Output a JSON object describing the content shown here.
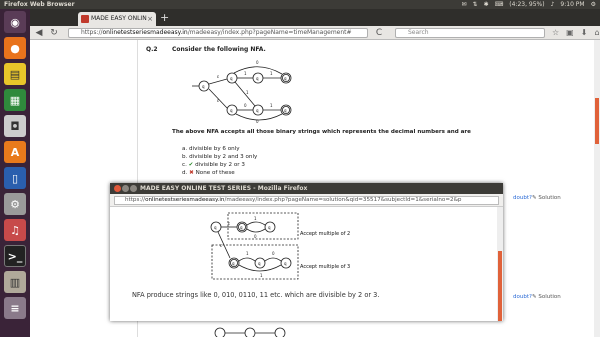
{
  "top_panel": {
    "app_name": "Firefox Web Browser",
    "battery": "(4:23, 95%)",
    "clock": "9:10 PM"
  },
  "browser": {
    "tab_title": "MADE EASY ONLIN",
    "new_tab": "+",
    "url_prefix": "https://",
    "url_host": "onlinetestseriesmadeeasy.in",
    "url_path": "/madeeasy/index.php?pageName=timeManagement#",
    "search_placeholder": "Search"
  },
  "question": {
    "number": "Q.2",
    "prompt": "Consider the following NFA.",
    "description": "The above NFA accepts all those binary strings which represents the decimal numbers and are",
    "options": [
      {
        "letter": "a.",
        "text": "divisible by 6 only",
        "mark": ""
      },
      {
        "letter": "b.",
        "text": "divisible by 2 and 3 only",
        "mark": ""
      },
      {
        "letter": "c.",
        "text": "divisible by 2 or 3",
        "mark": "✔"
      },
      {
        "letter": "d.",
        "text": "None of these",
        "mark": "✖"
      }
    ]
  },
  "side": {
    "doubt": "doubt?",
    "solution": "Solution"
  },
  "popup": {
    "title": "MADE EASY ONLINE TEST SERIES - Mozilla Firefox",
    "url_prefix": "https://",
    "url_host": "onlinetestseriesmadeeasy.in",
    "url_path": "/madeeasy/index.php?pageName=solution&qid=35517&subjectId=1&serialno=2&p",
    "label_1": "Accept multiple of 2",
    "label_2": "Accept multiple of 3",
    "caption": "NFA produce strings like 0, 010, 0110, 11 etc. which are divisible by 2 or 3."
  },
  "colors": {
    "accent": "#e0623a",
    "launcher": "#3a2338",
    "panel": "#3c3b37"
  }
}
